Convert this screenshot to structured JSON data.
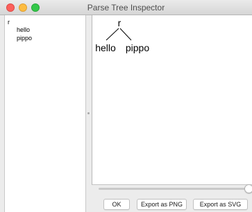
{
  "window": {
    "title": "Parse Tree Inspector"
  },
  "traffic_lights": {
    "close_color": "#fc605c",
    "minimize_color": "#fdbc40",
    "maximize_color": "#34c84a"
  },
  "tree_list": {
    "root": "r",
    "children": [
      "hello",
      "pippo"
    ]
  },
  "parse_tree": {
    "root": "r",
    "leaves": [
      "hello",
      "pippo"
    ]
  },
  "zoom_slider": {
    "level": 1.0
  },
  "buttons": {
    "ok": "OK",
    "export_png": "Export as PNG",
    "export_svg": "Export as SVG"
  }
}
